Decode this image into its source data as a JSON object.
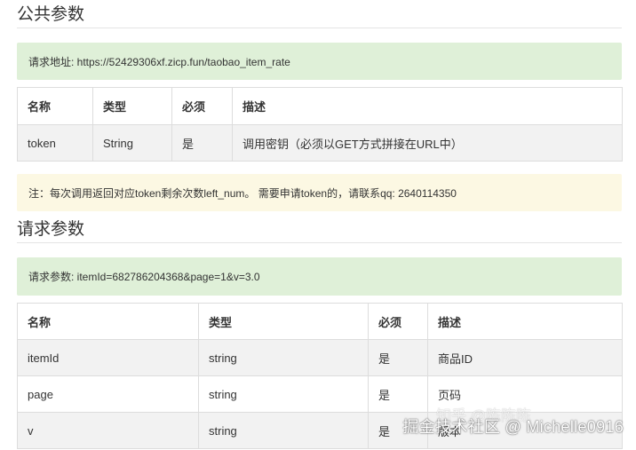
{
  "public_params": {
    "title": "公共参数",
    "url_note": "请求地址: https://52429306xf.zicp.fun/taobao_item_rate",
    "table": {
      "headers": [
        "名称",
        "类型",
        "必须",
        "描述"
      ],
      "rows": [
        [
          "token",
          "String",
          "是",
          "调用密钥（必须以GET方式拼接在URL中）"
        ]
      ]
    },
    "notice": "注：每次调用返回对应token剩余次数left_num。 需要申请token的，请联系qq: 2640114350"
  },
  "request_params": {
    "title": "请求参数",
    "example_note": "请求参数: itemId=682786204368&page=1&v=3.0",
    "table": {
      "headers": [
        "名称",
        "类型",
        "必须",
        "描述"
      ],
      "rows": [
        [
          "itemId",
          "string",
          "是",
          "商品ID"
        ],
        [
          "page",
          "string",
          "是",
          "页码"
        ],
        [
          "v",
          "string",
          "是",
          "版本"
        ]
      ]
    }
  },
  "watermark": {
    "zhihu": "知乎 @陈陈陈",
    "juejin": "掘金技术社区 @ Michelle0916"
  },
  "colors": {
    "green_box": "#dff0d8",
    "yellow_box": "#fcf8e3",
    "row_stripe": "#f2f2f2",
    "border": "#dddddd"
  }
}
